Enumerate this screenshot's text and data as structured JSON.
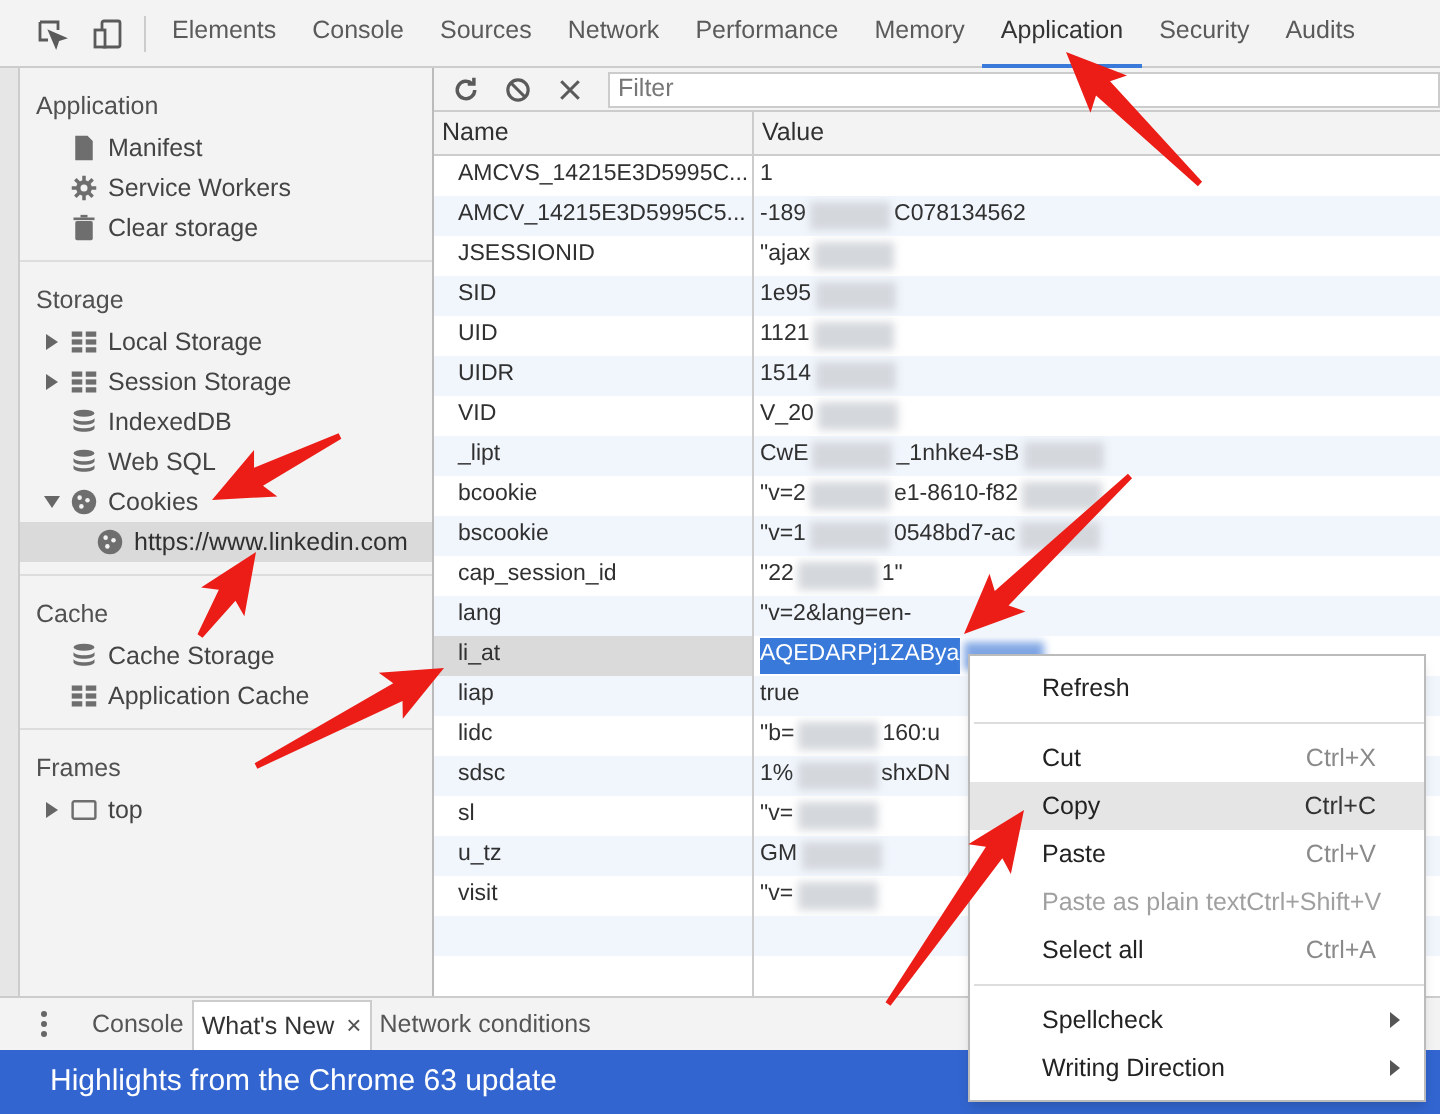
{
  "toolbar": {
    "tabs": [
      {
        "label": "Elements",
        "selected": false
      },
      {
        "label": "Console",
        "selected": false
      },
      {
        "label": "Sources",
        "selected": false
      },
      {
        "label": "Network",
        "selected": false
      },
      {
        "label": "Performance",
        "selected": false
      },
      {
        "label": "Memory",
        "selected": false
      },
      {
        "label": "Application",
        "selected": true
      },
      {
        "label": "Security",
        "selected": false
      },
      {
        "label": "Audits",
        "selected": false
      }
    ]
  },
  "sidebar": {
    "sections": [
      {
        "title": "Application",
        "items": [
          {
            "label": "Manifest",
            "kind": "file"
          },
          {
            "label": "Service Workers",
            "kind": "gear"
          },
          {
            "label": "Clear storage",
            "kind": "trash"
          }
        ]
      },
      {
        "title": "Storage",
        "items": [
          {
            "label": "Local Storage",
            "kind": "grid",
            "expanded": false
          },
          {
            "label": "Session Storage",
            "kind": "grid",
            "expanded": false
          },
          {
            "label": "IndexedDB",
            "kind": "database"
          },
          {
            "label": "Web SQL",
            "kind": "database"
          },
          {
            "label": "Cookies",
            "kind": "cookie",
            "expanded": true,
            "children": [
              {
                "label": "https://www.linkedin.com",
                "kind": "cookie",
                "selected": true
              }
            ]
          }
        ]
      },
      {
        "title": "Cache",
        "items": [
          {
            "label": "Cache Storage",
            "kind": "database"
          },
          {
            "label": "Application Cache",
            "kind": "grid"
          }
        ]
      },
      {
        "title": "Frames",
        "items": [
          {
            "label": "top",
            "kind": "frame",
            "expanded": false
          }
        ]
      }
    ]
  },
  "filter": {
    "placeholder": "Filter"
  },
  "table": {
    "columns": [
      "Name",
      "Value"
    ],
    "rows": [
      {
        "name": "AMCVS_14215E3D5995C...",
        "selected": false,
        "value": [
          {
            "kind": "text",
            "text": "1"
          }
        ]
      },
      {
        "name": "AMCV_14215E3D5995C5...",
        "selected": false,
        "value": [
          {
            "kind": "text",
            "text": "-189"
          },
          {
            "kind": "blur"
          },
          {
            "kind": "text",
            "text": "C078134562"
          }
        ]
      },
      {
        "name": "JSESSIONID",
        "selected": false,
        "value": [
          {
            "kind": "text",
            "text": "\"ajax"
          },
          {
            "kind": "blur"
          }
        ]
      },
      {
        "name": "SID",
        "selected": false,
        "value": [
          {
            "kind": "text",
            "text": "1e95"
          },
          {
            "kind": "blur"
          }
        ]
      },
      {
        "name": "UID",
        "selected": false,
        "value": [
          {
            "kind": "text",
            "text": "1121"
          },
          {
            "kind": "blur"
          }
        ]
      },
      {
        "name": "UIDR",
        "selected": false,
        "value": [
          {
            "kind": "text",
            "text": "1514"
          },
          {
            "kind": "blur"
          }
        ]
      },
      {
        "name": "VID",
        "selected": false,
        "value": [
          {
            "kind": "text",
            "text": "V_20"
          },
          {
            "kind": "blur"
          }
        ]
      },
      {
        "name": "_lipt",
        "selected": false,
        "value": [
          {
            "kind": "text",
            "text": "CwE"
          },
          {
            "kind": "blur"
          },
          {
            "kind": "text",
            "text": "_1nhke4-sB"
          },
          {
            "kind": "blur"
          }
        ]
      },
      {
        "name": "bcookie",
        "selected": false,
        "value": [
          {
            "kind": "text",
            "text": "\"v=2"
          },
          {
            "kind": "blur"
          },
          {
            "kind": "text",
            "text": "e1-8610-f82"
          },
          {
            "kind": "blur"
          }
        ]
      },
      {
        "name": "bscookie",
        "selected": false,
        "value": [
          {
            "kind": "text",
            "text": "\"v=1"
          },
          {
            "kind": "blur"
          },
          {
            "kind": "text",
            "text": "0548bd7-ac"
          },
          {
            "kind": "blur"
          }
        ]
      },
      {
        "name": "cap_session_id",
        "selected": false,
        "value": [
          {
            "kind": "text",
            "text": "\"22"
          },
          {
            "kind": "blur"
          },
          {
            "kind": "text",
            "text": "1\""
          }
        ]
      },
      {
        "name": "lang",
        "selected": false,
        "value": [
          {
            "kind": "text",
            "text": "\"v=2&lang=en-"
          }
        ]
      },
      {
        "name": "li_at",
        "selected": true,
        "value": [
          {
            "kind": "text",
            "text": "AQEDARPj1ZABya"
          },
          {
            "kind": "blur"
          }
        ]
      },
      {
        "name": "liap",
        "selected": false,
        "value": [
          {
            "kind": "text",
            "text": "true"
          }
        ]
      },
      {
        "name": "lidc",
        "selected": false,
        "value": [
          {
            "kind": "text",
            "text": "\"b="
          },
          {
            "kind": "blur"
          },
          {
            "kind": "text",
            "text": "160:u"
          }
        ]
      },
      {
        "name": "sdsc",
        "selected": false,
        "value": [
          {
            "kind": "text",
            "text": "1%"
          },
          {
            "kind": "blur"
          },
          {
            "kind": "text",
            "text": "shxDN"
          }
        ]
      },
      {
        "name": "sl",
        "selected": false,
        "value": [
          {
            "kind": "text",
            "text": "\"v="
          },
          {
            "kind": "blur"
          }
        ]
      },
      {
        "name": "u_tz",
        "selected": false,
        "value": [
          {
            "kind": "text",
            "text": "GM"
          },
          {
            "kind": "blur"
          }
        ]
      },
      {
        "name": "visit",
        "selected": false,
        "value": [
          {
            "kind": "text",
            "text": "\"v="
          },
          {
            "kind": "blur"
          }
        ]
      }
    ]
  },
  "context_menu": {
    "items": [
      {
        "kind": "item",
        "label": "Refresh",
        "selected": false,
        "disabled": false
      },
      {
        "kind": "separator"
      },
      {
        "kind": "item",
        "label": "Cut",
        "shortcut": "Ctrl+X",
        "selected": false,
        "disabled": false
      },
      {
        "kind": "item",
        "label": "Copy",
        "shortcut": "Ctrl+C",
        "selected": true,
        "disabled": false
      },
      {
        "kind": "item",
        "label": "Paste",
        "shortcut": "Ctrl+V",
        "selected": false,
        "disabled": false
      },
      {
        "kind": "item",
        "label": "Paste as plain text",
        "shortcut": "Ctrl+Shift+V",
        "selected": false,
        "disabled": true
      },
      {
        "kind": "item",
        "label": "Select all",
        "shortcut": "Ctrl+A",
        "selected": false,
        "disabled": false
      },
      {
        "kind": "separator"
      },
      {
        "kind": "item",
        "label": "Spellcheck",
        "submenu": true,
        "selected": false,
        "disabled": false
      },
      {
        "kind": "item",
        "label": "Writing Direction",
        "submenu": true,
        "selected": false,
        "disabled": false
      }
    ]
  },
  "drawer": {
    "tabs": [
      {
        "label": "Console",
        "selected": false,
        "closable": false
      },
      {
        "label": "What's New",
        "selected": true,
        "closable": true
      },
      {
        "label": "Network conditions",
        "selected": false,
        "closable": false
      }
    ],
    "close_glyph": "×",
    "banner": "Highlights from the Chrome 63 update"
  }
}
